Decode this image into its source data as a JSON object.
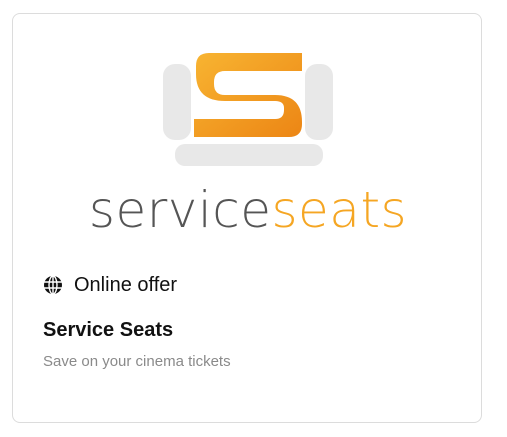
{
  "card": {
    "logo": {
      "word_part_1": "service",
      "word_part_2": "seats",
      "colors": {
        "orange": "#f5a623",
        "dark_orange": "#e8830f",
        "gray_text": "#555555",
        "seat_gray": "#e6e6e6"
      }
    },
    "offer_type": {
      "icon": "globe-icon",
      "label": "Online offer"
    },
    "title": "Service Seats",
    "subtitle": "Save on your cinema tickets"
  }
}
